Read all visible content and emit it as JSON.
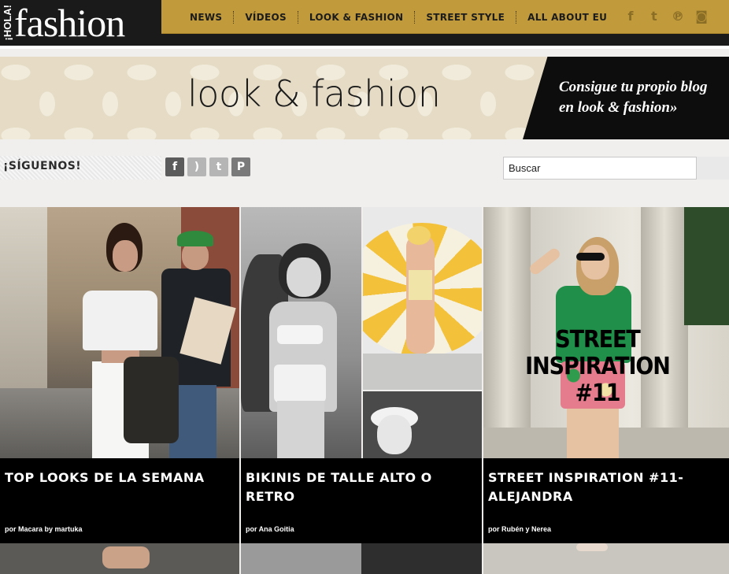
{
  "header": {
    "logo_hola": "¡HOLA!",
    "logo_fashion": "fashion",
    "nav": [
      "NEWS",
      "VÍDEOS",
      "LOOK & FASHION",
      "STREET STYLE",
      "ALL ABOUT EU"
    ],
    "social_icons": [
      "facebook-icon",
      "twitter-icon",
      "pinterest-icon",
      "instagram-icon"
    ]
  },
  "banner": {
    "title": "look & fashion",
    "cta_line1": "Consigue tu propio blog",
    "cta_line2": "en look & fashion»"
  },
  "follow": {
    "label": "¡SÍGUENOS!",
    "icons": [
      "facebook-icon",
      "rss-icon",
      "twitter-icon",
      "pinterest-icon"
    ]
  },
  "search": {
    "value": "Buscar"
  },
  "cards": [
    {
      "title": "TOP LOOKS DE LA SEMANA",
      "author": "por Macara by martuka"
    },
    {
      "title": "BIKINIS DE TALLE ALTO O RETRO",
      "author": "por Ana Goitia"
    },
    {
      "title": "STREET INSPIRATION #11- ALEJANDRA",
      "author": "por Rubén y Nerea",
      "overlay_line1": "STREET INSPIRATION",
      "overlay_line2": "#11"
    }
  ],
  "colors": {
    "nav_gold": "#c19a3c",
    "dark": "#1a1a1a",
    "banner_beige": "#e6dcc6"
  }
}
